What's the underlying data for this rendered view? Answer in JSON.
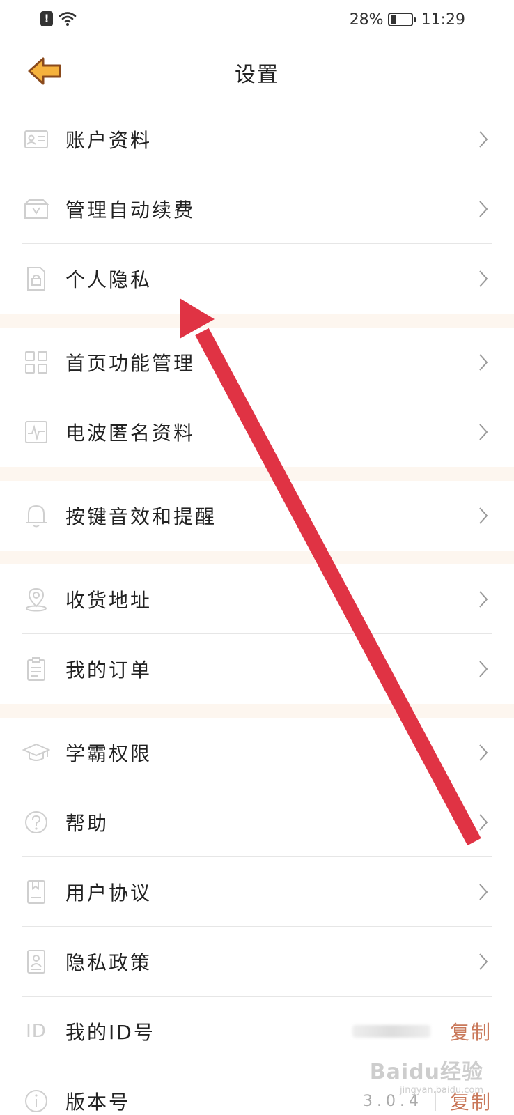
{
  "status_bar": {
    "alert_icon": "alert-icon",
    "wifi_icon": "wifi-icon",
    "battery_percent": "28%",
    "battery_level": 0.28,
    "time": "11:29"
  },
  "header": {
    "back_icon": "back-arrow-icon",
    "title": "设置"
  },
  "accent_color": "#c9785a",
  "annotation_arrow_color": "#e03344",
  "rows": {
    "account": {
      "label": "账户资料",
      "icon": "id-card-icon"
    },
    "auto_renew": {
      "label": "管理自动续费",
      "icon": "wallet-icon"
    },
    "privacy": {
      "label": "个人隐私",
      "icon": "lock-file-icon"
    },
    "home_features": {
      "label": "首页功能管理",
      "icon": "grid-icon"
    },
    "anonymous": {
      "label": "电波匿名资料",
      "icon": "waveform-icon"
    },
    "sound": {
      "label": "按键音效和提醒",
      "icon": "bell-icon"
    },
    "address": {
      "label": "收货地址",
      "icon": "location-pin-icon"
    },
    "orders": {
      "label": "我的订单",
      "icon": "clipboard-icon"
    },
    "privileges": {
      "label": "学霸权限",
      "icon": "graduation-cap-icon"
    },
    "help": {
      "label": "帮助",
      "icon": "question-icon"
    },
    "agreement": {
      "label": "用户协议",
      "icon": "document-icon"
    },
    "policy": {
      "label": "隐私政策",
      "icon": "user-document-icon"
    },
    "my_id": {
      "label": "我的ID号",
      "icon_text": "ID",
      "action": "复制"
    },
    "version": {
      "label": "版本号",
      "icon": "info-icon",
      "value": "3.0.4",
      "action": "复制"
    }
  },
  "watermark": {
    "main": "Baidu经验",
    "sub": "jingyan.baidu.com"
  }
}
